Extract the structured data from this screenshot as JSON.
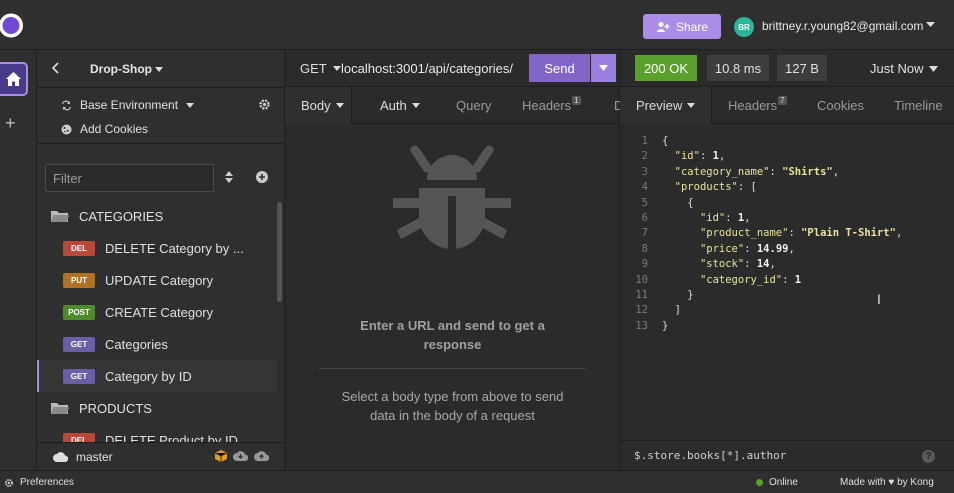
{
  "topbar": {
    "share_label": "Share",
    "user_initials": "BR",
    "user_email": "brittney.r.young82@gmail.com"
  },
  "sidebar": {
    "project_name": "Drop-Shop",
    "environment": "Base Environment",
    "add_cookies": "Add Cookies",
    "filter_placeholder": "Filter",
    "tree": [
      {
        "type": "folder",
        "label": "CATEGORIES"
      },
      {
        "type": "request",
        "method": "DEL",
        "method_color": "#b84a3a",
        "label": "DELETE Category by ..."
      },
      {
        "type": "request",
        "method": "PUT",
        "method_color": "#b07325",
        "label": "UPDATE Category"
      },
      {
        "type": "request",
        "method": "POST",
        "method_color": "#4f8a2c",
        "label": "CREATE Category"
      },
      {
        "type": "request",
        "method": "GET",
        "method_color": "#6a5fa6",
        "label": "Categories"
      },
      {
        "type": "request",
        "method": "GET",
        "method_color": "#6a5fa6",
        "label": "Category by ID",
        "active": true
      },
      {
        "type": "folder",
        "label": "PRODUCTS"
      },
      {
        "type": "request",
        "method": "DEL",
        "method_color": "#b84a3a",
        "label": "DELETE Product by ID"
      }
    ],
    "branch": "master"
  },
  "request": {
    "method": "GET",
    "url": "localhost:3001/api/categories/",
    "send_label": "Send",
    "tabs": {
      "body": "Body",
      "auth": "Auth",
      "query": "Query",
      "headers": "Headers",
      "headers_count": "1",
      "docs_partial": "D"
    },
    "empty_title": "Enter a URL and send to get a response",
    "empty_sub": "Select a body type from above to send data in the body of a request"
  },
  "response": {
    "status": "200 OK",
    "time": "10.8 ms",
    "size": "127 B",
    "when": "Just Now",
    "tabs": {
      "preview": "Preview",
      "headers": "Headers",
      "headers_count": "7",
      "cookies": "Cookies",
      "timeline": "Timeline"
    },
    "code_lines": [
      [
        [
          "p",
          "{"
        ]
      ],
      [
        [
          "p",
          "  "
        ],
        [
          "k",
          "\"id\""
        ],
        [
          "p",
          ": "
        ],
        [
          "n",
          "1"
        ],
        [
          "p",
          ","
        ]
      ],
      [
        [
          "p",
          "  "
        ],
        [
          "k",
          "\"category_name\""
        ],
        [
          "p",
          ": "
        ],
        [
          "s",
          "\"Shirts\""
        ],
        [
          "p",
          ","
        ]
      ],
      [
        [
          "p",
          "  "
        ],
        [
          "k",
          "\"products\""
        ],
        [
          "p",
          ": ["
        ]
      ],
      [
        [
          "p",
          "    {"
        ]
      ],
      [
        [
          "p",
          "      "
        ],
        [
          "k",
          "\"id\""
        ],
        [
          "p",
          ": "
        ],
        [
          "n",
          "1"
        ],
        [
          "p",
          ","
        ]
      ],
      [
        [
          "p",
          "      "
        ],
        [
          "k",
          "\"product_name\""
        ],
        [
          "p",
          ": "
        ],
        [
          "s",
          "\"Plain T-Shirt\""
        ],
        [
          "p",
          ","
        ]
      ],
      [
        [
          "p",
          "      "
        ],
        [
          "k",
          "\"price\""
        ],
        [
          "p",
          ": "
        ],
        [
          "n",
          "14.99"
        ],
        [
          "p",
          ","
        ]
      ],
      [
        [
          "p",
          "      "
        ],
        [
          "k",
          "\"stock\""
        ],
        [
          "p",
          ": "
        ],
        [
          "n",
          "14"
        ],
        [
          "p",
          ","
        ]
      ],
      [
        [
          "p",
          "      "
        ],
        [
          "k",
          "\"category_id\""
        ],
        [
          "p",
          ": "
        ],
        [
          "n",
          "1"
        ]
      ],
      [
        [
          "p",
          "    }"
        ]
      ],
      [
        [
          "p",
          "  ]"
        ]
      ],
      [
        [
          "p",
          "}"
        ]
      ]
    ],
    "jsonpath": "$.store.books[*].author"
  },
  "statusbar": {
    "preferences": "Preferences",
    "online": "Online",
    "made_with": "Made with ♥ by Kong"
  },
  "colors": {
    "accent": "#a98de6",
    "ok": "#5aa02c"
  },
  "icons": [
    "logo-icon",
    "share-icon",
    "home-icon",
    "bug-icon",
    "gear-icon",
    "cookie-icon",
    "cloud-icon",
    "folder-icon"
  ]
}
